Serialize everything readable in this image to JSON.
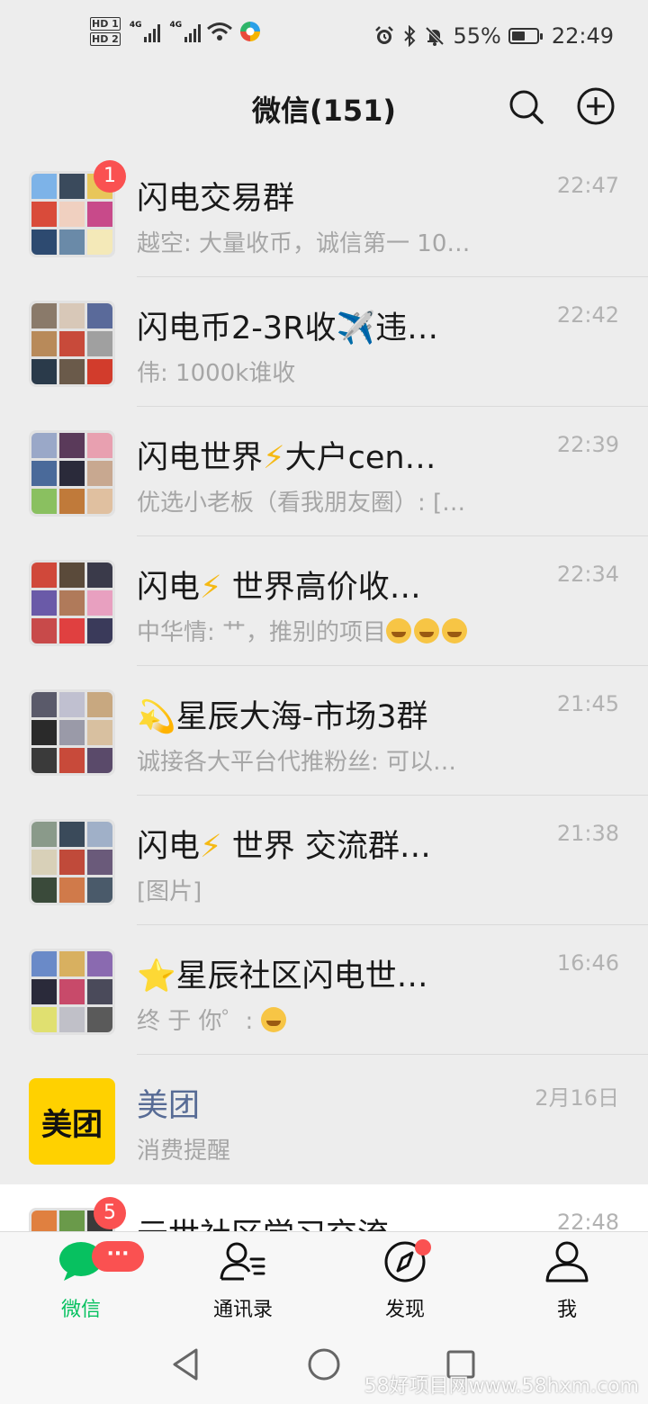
{
  "status_bar": {
    "hd1": "HD 1",
    "hd2": "HD 2",
    "net1": "4G",
    "net2": "4G",
    "battery_pct": "55%",
    "battery_level": 0.55,
    "time": "22:49"
  },
  "header": {
    "title": "微信(151)",
    "search_icon": "search-icon",
    "add_icon": "plus-circle-icon"
  },
  "chats": [
    {
      "name": "闪电交易群",
      "preview": "越空: 大量收币，诚信第一 10…",
      "time": "22:47",
      "badge": "1",
      "colors": [
        "#7db3e8",
        "#3a4a5c",
        "#e8c65a",
        "#d94b3a",
        "#f0d0c0",
        "#c84a8a",
        "#2d4a70",
        "#6a8aa8",
        "#f4e9b8"
      ]
    },
    {
      "name": "闪电币2-3R收✈️违…",
      "preview": "伟: 1000k谁收",
      "time": "22:42",
      "badge": "",
      "colors": [
        "#8a7a6a",
        "#d8c8b8",
        "#5a6a9a",
        "#b88a5a",
        "#c84a3a",
        "#a0a0a0",
        "#2a3a4a",
        "#6a5a4a",
        "#d23c2c"
      ]
    },
    {
      "name_pre": "闪电世界",
      "name_post": "大户cen…",
      "preview": "优选小老板（看我朋友圈）: […",
      "time": "22:39",
      "badge": "",
      "colors": [
        "#9aa8c8",
        "#5a3a5a",
        "#e8a0b0",
        "#4a6a9a",
        "#2a2a3a",
        "#c8a890",
        "#8ac060",
        "#c07a3a",
        "#e0c0a0"
      ]
    },
    {
      "name_pre": "闪电",
      "name_post": " 世界高价收…",
      "preview_pre": "中华情: 艹，推别的项目",
      "time": "22:34",
      "badge": "",
      "colors": [
        "#d0483a",
        "#5a4a3a",
        "#3a3a4a",
        "#6a5aa8",
        "#b07a5a",
        "#e8a0c0",
        "#c84a4a",
        "#e04040",
        "#3a3a5a"
      ]
    },
    {
      "name": "💫星辰大海-市场3群",
      "preview": "诚接各大平台代推粉丝: 可以…",
      "time": "21:45",
      "badge": "",
      "colors": [
        "#5a5a6a",
        "#c0c0d0",
        "#c8a880",
        "#2a2a2a",
        "#9a9aa8",
        "#d8c0a0",
        "#3a3a3a",
        "#c84a3a",
        "#5a4a6a"
      ]
    },
    {
      "name_pre": "闪电",
      "name_post": " 世界 交流群…",
      "preview": "[图片]",
      "time": "21:38",
      "badge": "",
      "colors": [
        "#8a9a8a",
        "#3a4a5a",
        "#a0b0c8",
        "#d8d0b8",
        "#c04a3a",
        "#6a5a7a",
        "#3a4a3a",
        "#d07a4a",
        "#4a5a6a"
      ]
    },
    {
      "name": "⭐星辰社区闪电世…",
      "preview_pre": "终 于 你゜:",
      "time": "16:46",
      "badge": "",
      "colors": [
        "#6a8ac8",
        "#d8b060",
        "#8a6ab0",
        "#2a2a3a",
        "#c84a6a",
        "#4a4a5a",
        "#e0e070",
        "#c0c0c8",
        "#5a5a5a"
      ]
    },
    {
      "name": "美团",
      "preview": "消费提醒",
      "time": "2月16日",
      "badge": "",
      "brand": "美团",
      "plain": true
    },
    {
      "name": "元世社区学习交流",
      "preview": "",
      "time": "22:48",
      "badge": "5",
      "colors": [
        "#e08040",
        "#6a9a4a",
        "#3a3a3a",
        "#c86a3a",
        "#8ab06a",
        "#2a2a2a",
        "#d0a060",
        "#5a7a4a",
        "#4a4a4a"
      ]
    }
  ],
  "tabs": [
    {
      "label": "微信",
      "icon": "chat-bubble-icon",
      "badge": "···"
    },
    {
      "label": "通讯录",
      "icon": "contacts-icon"
    },
    {
      "label": "发现",
      "icon": "compass-icon"
    },
    {
      "label": "我",
      "icon": "person-icon"
    }
  ],
  "watermark": "58好项目网www.58hxm.com",
  "colors": {
    "accent": "#07c160",
    "badge": "#fa5151",
    "link": "#576b95",
    "brand": "#ffd100"
  }
}
